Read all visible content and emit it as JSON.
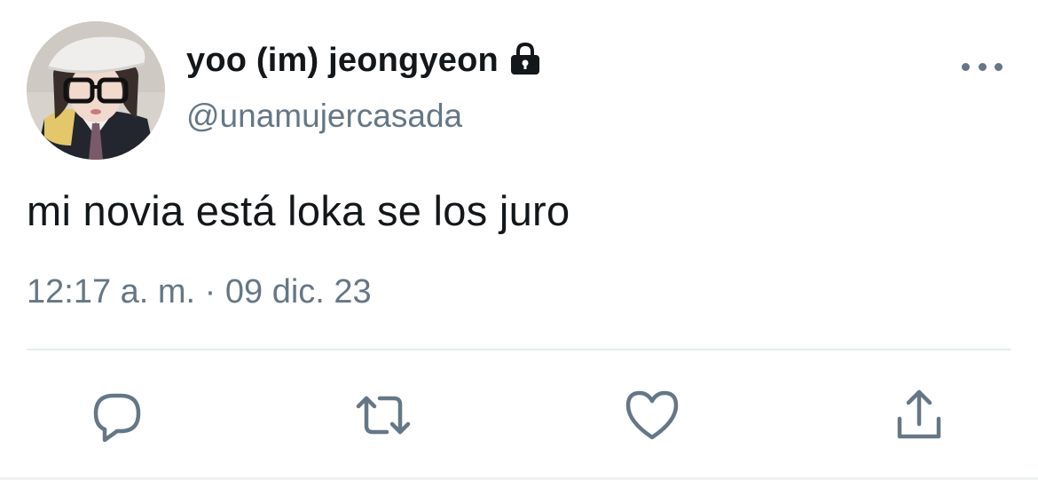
{
  "tweet": {
    "display_name": "yoo (im) jeongyeon",
    "handle": "@unamujercasada",
    "protected": true,
    "text": "mi novia está loka se los juro",
    "timestamp": "12:17 a. m. · 09 dic. 23"
  },
  "icons": {
    "lock": "lock-icon",
    "more": "more-icon",
    "reply": "reply-icon",
    "retweet": "retweet-icon",
    "like": "heart-icon",
    "share": "share-icon"
  },
  "colors": {
    "primary_text": "#14171a",
    "secondary_text": "#657786",
    "divider": "#e6ecf0"
  }
}
